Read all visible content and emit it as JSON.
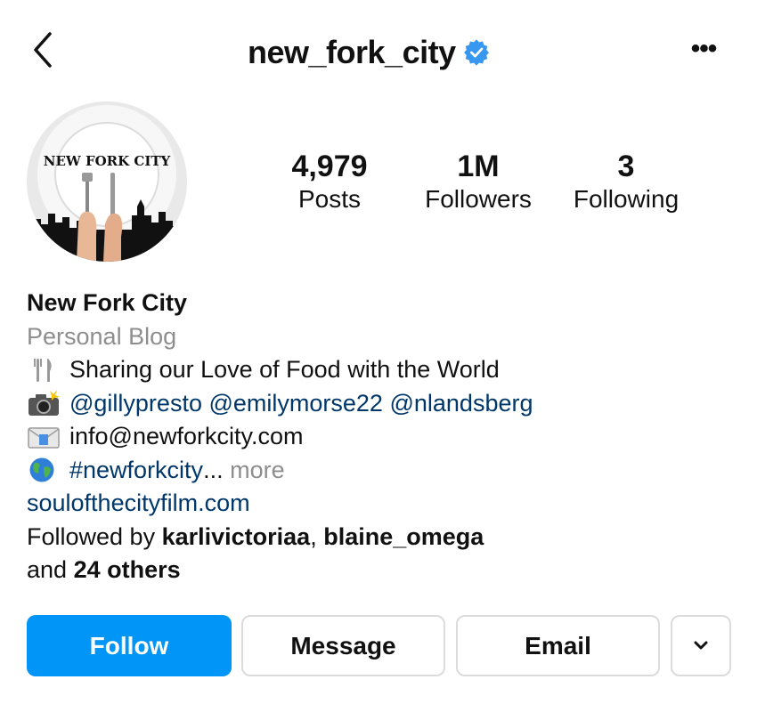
{
  "header": {
    "username": "new_fork_city",
    "verified": true,
    "back_icon": "chevron-left-icon",
    "more_icon": "more-horizontal-icon",
    "more_label": "•••"
  },
  "avatar": {
    "logo_text": "NEW FORK CITY"
  },
  "stats": [
    {
      "value": "4,979",
      "label": "Posts"
    },
    {
      "value": "1M",
      "label": "Followers"
    },
    {
      "value": "3",
      "label": "Following"
    }
  ],
  "bio": {
    "name": "New Fork City",
    "category": "Personal Blog",
    "line1": {
      "icon": "fork-knife-icon",
      "text": "Sharing our Love of Food with the World"
    },
    "line2": {
      "icon": "camera-flash-icon",
      "mentions": [
        "@gillypresto",
        "@emilymorse22",
        "@nlandsberg"
      ]
    },
    "line3": {
      "icon": "envelope-icon",
      "text": "info@newforkcity.com"
    },
    "line4": {
      "icon": "globe-icon",
      "hashtag": "#newforkcity",
      "ellipsis": "...",
      "more": "more"
    },
    "website": "soulofthecityfilm.com",
    "followed_by": {
      "prefix": "Followed by ",
      "users": [
        "karlivictoriaa",
        "blaine_omega"
      ],
      "separator": ", ",
      "and_text": "and ",
      "others": "24 others"
    }
  },
  "actions": {
    "follow": "Follow",
    "message": "Message",
    "email": "Email",
    "dropdown_icon": "chevron-down-icon"
  },
  "colors": {
    "follow_bg": "#0095f6",
    "link": "#00376b",
    "muted": "#8e8e8e",
    "verified_badge": "#3897f0",
    "border": "#dbdbdb"
  }
}
